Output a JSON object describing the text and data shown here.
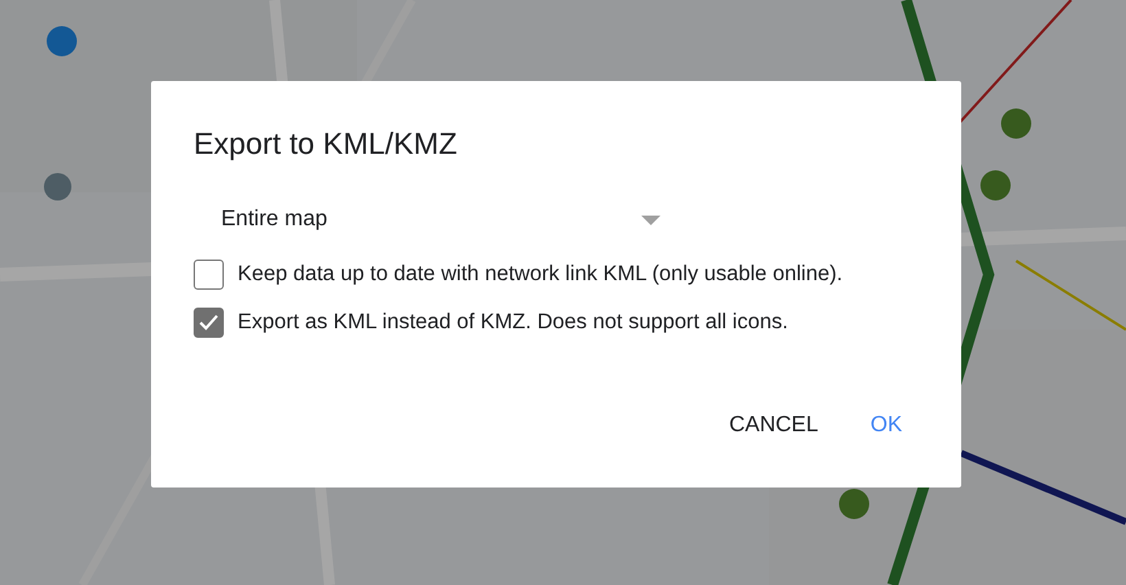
{
  "dialog": {
    "title": "Export to KML/KMZ",
    "dropdown": {
      "value": "Entire map"
    },
    "options": [
      {
        "label": "Keep data up to date with network link KML (only usable online).",
        "checked": false
      },
      {
        "label": "Export as KML instead of KMZ. Does not support all icons.",
        "checked": true
      }
    ],
    "buttons": [
      {
        "label": "CANCEL",
        "kind": "secondary"
      },
      {
        "label": "OK",
        "kind": "primary"
      }
    ]
  }
}
